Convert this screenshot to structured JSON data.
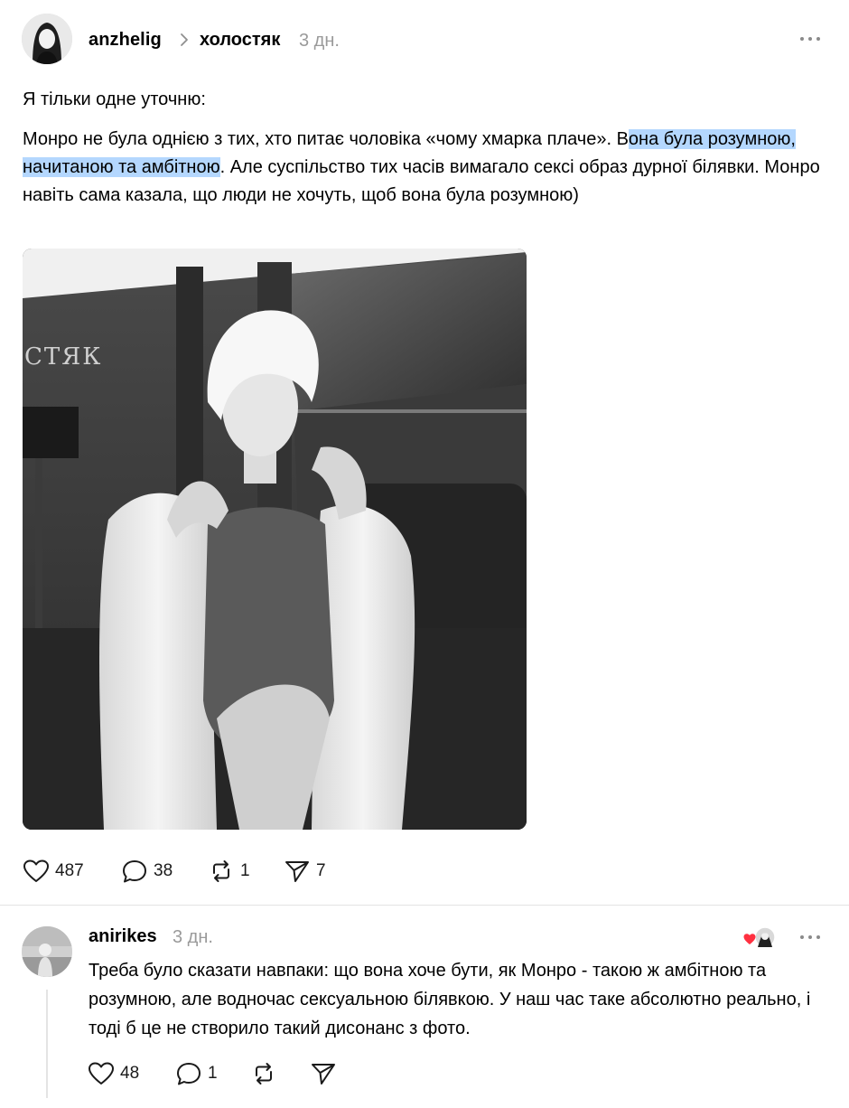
{
  "post": {
    "author": "anzhelig",
    "community": "холостяк",
    "time": "3 дн.",
    "text_line1": "Я тільки одне уточню:",
    "text_p2_before": "Монро не була однією з тих, хто питає чоловіка «чому хмарка плаче». В",
    "text_p2_highlight": "она була розумною, начитаною та амбітною",
    "text_p2_after": ". Але суспільство тих часів вимагало сексі образ дурної білявки. Монро навіть сама казала, що люди не хочуть, щоб вона була розумною)",
    "image_sign_text": "СТЯК",
    "likes": "487",
    "comments": "38",
    "reposts": "1",
    "shares": "7"
  },
  "reply": {
    "author": "anirikes",
    "time": "3 дн.",
    "text": "Треба було сказати навпаки: що вона хоче бути, як Монро - такою ж амбітною та розумною, але водночас сексуальною білявкою. У наш час таке абсолютно реально, і тоді б це не створило такий дисонанс з фото.",
    "likes": "48",
    "comments": "1"
  },
  "icons": {
    "more": "more-horizontal-icon",
    "chevron": "chevron-right-icon",
    "like": "heart-icon",
    "comment": "comment-bubble-icon",
    "repost": "repost-arrows-icon",
    "share": "paper-plane-icon",
    "liked_by_author": "heart-badge-icon"
  },
  "colors": {
    "highlight": "#b4d7fe",
    "muted": "#9a9a9a",
    "heart_red": "#ff3040"
  }
}
